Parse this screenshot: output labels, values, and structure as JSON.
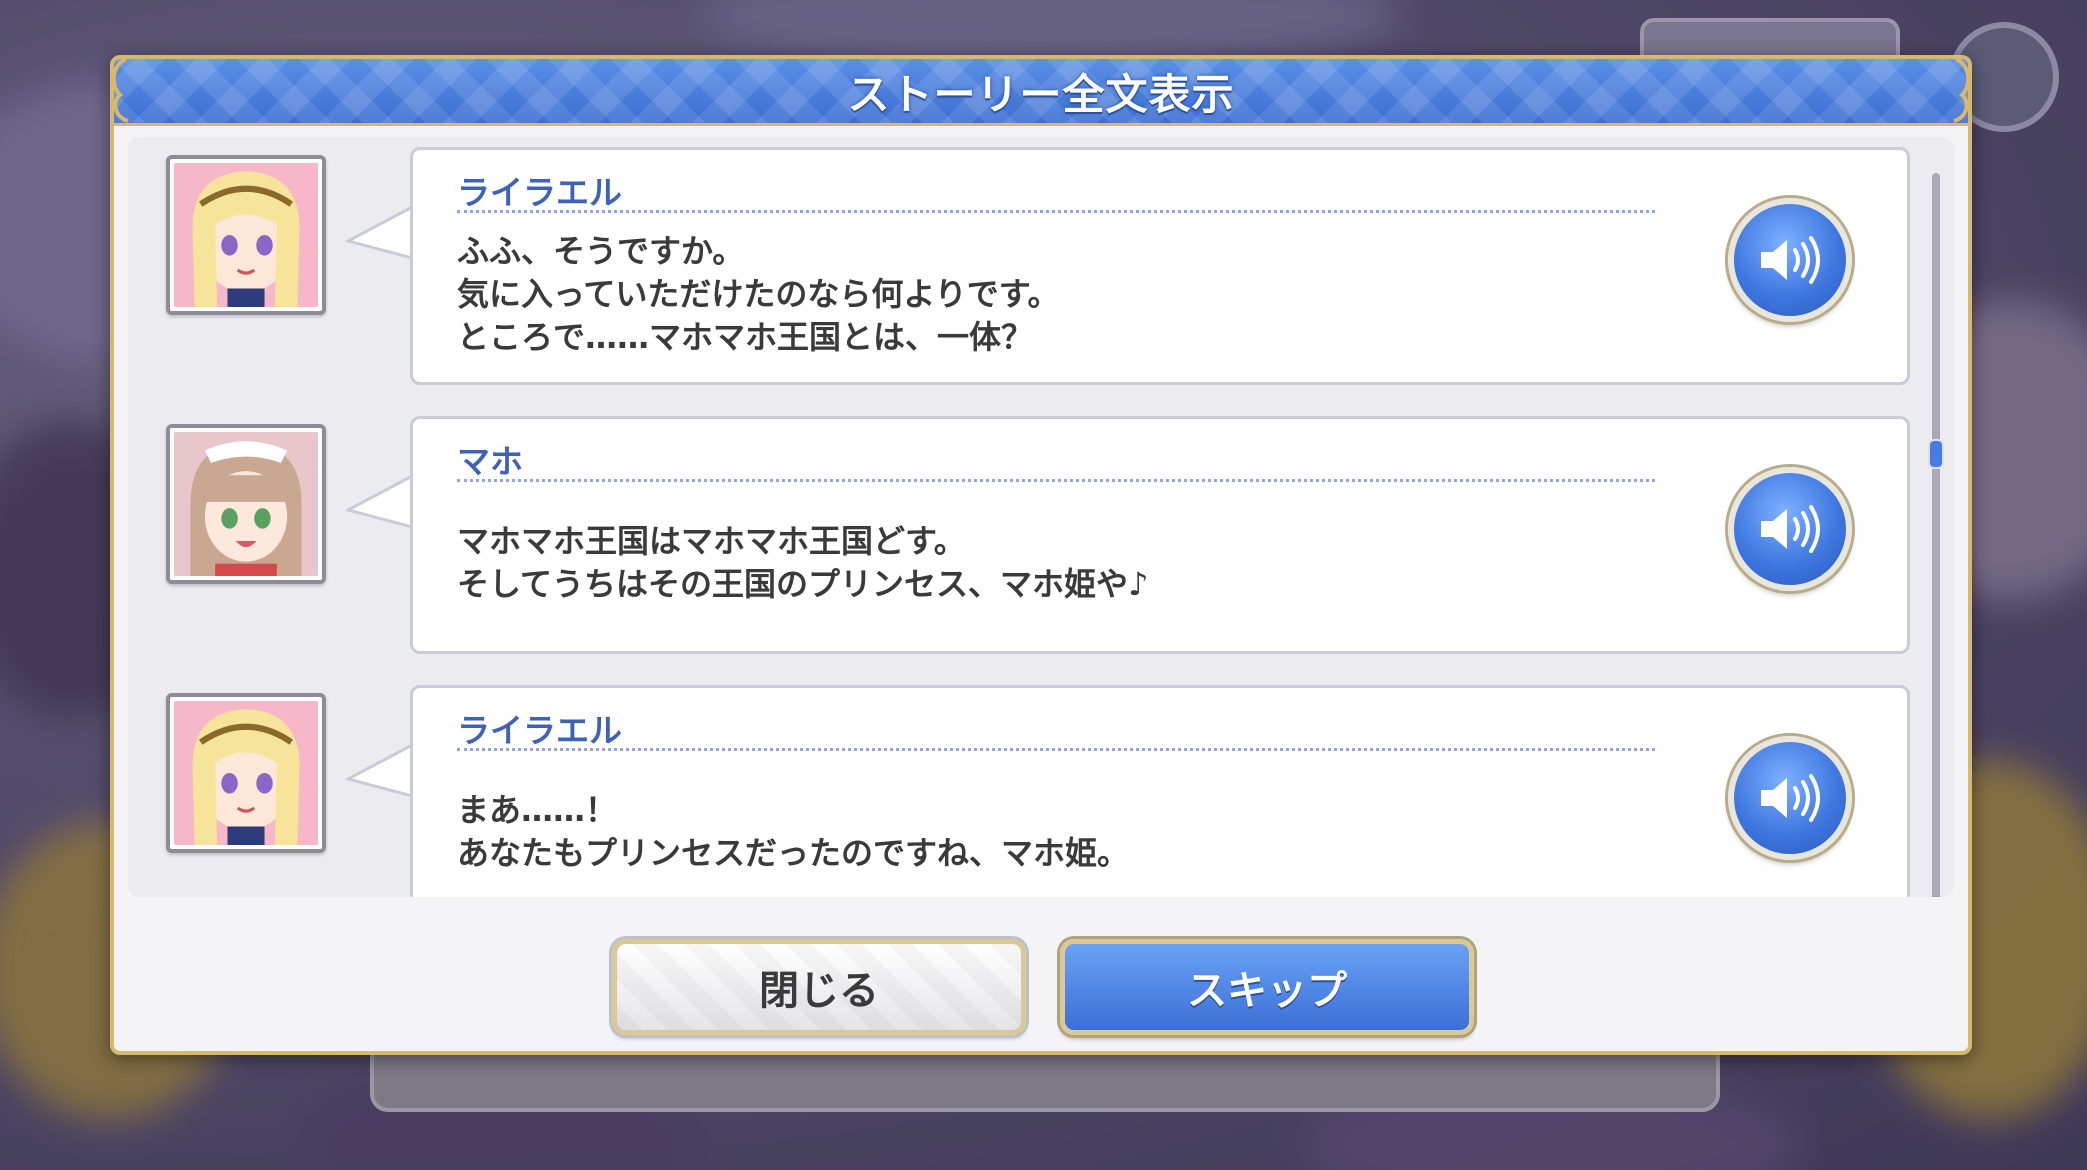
{
  "dialog": {
    "title": "ストーリー全文表示"
  },
  "entries": [
    {
      "speaker": "ライラエル",
      "lines": [
        "ふふ、そうですか。",
        "気に入っていただけたのなら何よりです。",
        "ところで……マホマホ王国とは、一体？"
      ],
      "avatar_icon": "lyrael-portrait",
      "voice_icon": "speaker-icon"
    },
    {
      "speaker": "マホ",
      "lines": [
        "",
        "マホマホ王国はマホマホ王国どす。",
        "そしてうちはその王国のプリンセス、マホ姫や♪"
      ],
      "avatar_icon": "maho-portrait",
      "voice_icon": "speaker-icon"
    },
    {
      "speaker": "ライラエル",
      "lines": [
        "",
        "まあ……！",
        "あなたもプリンセスだったのですね、マホ姫。"
      ],
      "avatar_icon": "lyrael-portrait",
      "voice_icon": "speaker-icon"
    }
  ],
  "buttons": {
    "close_label": "閉じる",
    "skip_label": "スキップ"
  },
  "colors": {
    "header_blue": "#3d6fd2",
    "speaker_name": "#3f62b8",
    "gold_border": "#d8b86a"
  }
}
